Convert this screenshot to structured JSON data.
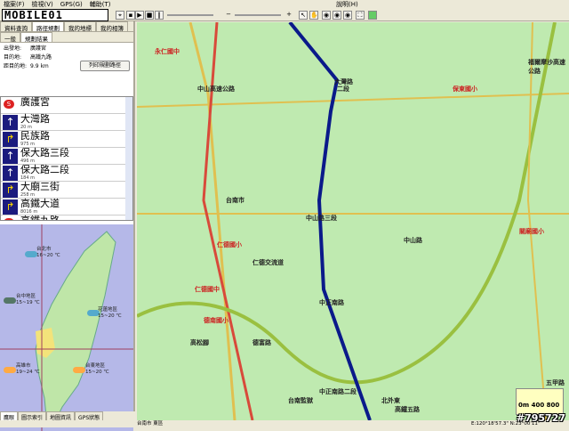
{
  "menu": {
    "file": "檔案(F)",
    "view": "檢視(V)",
    "gps": "GPS(G)",
    "tools": "輔助(T)",
    "help": "說明(H)"
  },
  "logo": "MOBILE01",
  "left": {
    "tabs": [
      "資料查詢",
      "路徑規劃",
      "我的地標",
      "我的相簿"
    ],
    "subtabs": [
      "一般",
      "規劃結果"
    ],
    "start_label": "出發地:",
    "start": "廣護宮",
    "dest_label": "目的地:",
    "dest": "高鐵九路",
    "dist_label": "距目的地:",
    "dist": "9.9 km",
    "print_btn": "列印規劃路徑",
    "steps": [
      {
        "name": "廣護宮",
        "dist": "",
        "type": "start"
      },
      {
        "name": "大灣路",
        "dist": "20 m",
        "type": "straight"
      },
      {
        "name": "民族路",
        "dist": "975 m",
        "type": "turn"
      },
      {
        "name": "保大路三段",
        "dist": "496 m",
        "type": "straight"
      },
      {
        "name": "保大路二段",
        "dist": "184 m",
        "type": "straight"
      },
      {
        "name": "大廟三街",
        "dist": "258 m",
        "type": "turn"
      },
      {
        "name": "高鐵大道",
        "dist": "8016 m",
        "type": "turn"
      },
      {
        "name": "高鐵九路",
        "dist": "",
        "type": "end"
      }
    ],
    "weather": [
      {
        "city": "台北市",
        "temp": "16~20 ℃"
      },
      {
        "city": "台中地區",
        "temp": "15~19 ℃"
      },
      {
        "city": "花蓮地區",
        "temp": "15~20 ℃"
      },
      {
        "city": "高雄市",
        "temp": "19~24 ℃"
      },
      {
        "city": "台東地區",
        "temp": "15~20 ℃"
      }
    ],
    "bottom_tabs": [
      "鷹眼",
      "圖示索引",
      "地圖資訊",
      "GPS狀態"
    ]
  },
  "map": {
    "labels": [
      "永仁國中",
      "中山高速公路",
      "大灣路",
      "保東國小",
      "中山路三段",
      "仁德國小",
      "仁德國中",
      "德南國小",
      "中正南路",
      "中山路",
      "福爾摩沙高速公路",
      "二段",
      "台南市",
      "高松腳",
      "德富路",
      "五甲路",
      "中正南路二段",
      "北外東",
      "台南監獄",
      "高鐵五路",
      "仁德交流道",
      "關廟國小"
    ],
    "scale": {
      "s0": "0m",
      "s1": "400",
      "s2": "800"
    }
  },
  "status": {
    "district": "台南市 東區",
    "coords": "E:120°18'57.3\"  N:23°00'11\""
  },
  "watermark": "#795727"
}
